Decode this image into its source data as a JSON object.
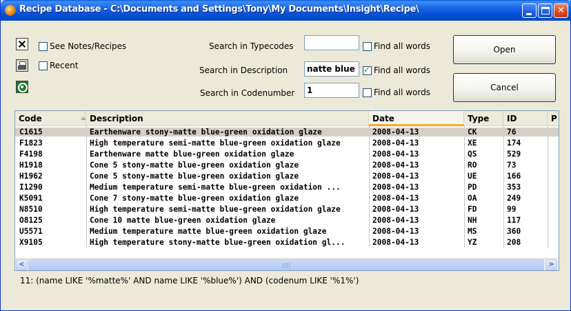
{
  "window": {
    "title": "Recipe Database - C:\\Documents and Settings\\Tony\\My Documents\\Insight\\Recipe\\"
  },
  "toolbar": {
    "icons": [
      "delete-icon",
      "print-icon",
      "target-icon"
    ],
    "see_notes_label": "See Notes/Recipes",
    "see_notes_checked": false,
    "recent_label": "Recent",
    "recent_checked": false
  },
  "search": {
    "typecodes_label": "Search in Typecodes",
    "typecodes_value": "",
    "typecodes_findall_label": "Find all words",
    "typecodes_findall_checked": false,
    "description_label": "Search in Description",
    "description_value": "natte blue",
    "description_findall_label": "Find all words",
    "description_findall_checked": true,
    "codenumber_label": "Search in Codenumber",
    "codenumber_value": "1",
    "codenumber_findall_label": "Find all words",
    "codenumber_findall_checked": false
  },
  "buttons": {
    "open": "Open",
    "cancel": "Cancel"
  },
  "table": {
    "columns": [
      "Code",
      "Description",
      "Date",
      "Type",
      "ID",
      "P"
    ],
    "sorted_column": "Date",
    "rows": [
      [
        "C1615",
        "Earthenware stony-matte blue-green oxidation glaze",
        "2008-04-13",
        "CK",
        "76"
      ],
      [
        "F1823",
        "High temperature semi-matte blue-green oxidation glaze",
        "2008-04-13",
        "XE",
        "174"
      ],
      [
        "F4198",
        "Earthenware matte blue-green oxidation glaze",
        "2008-04-13",
        "QS",
        "529"
      ],
      [
        "H1918",
        "Cone 5 stony-matte blue-green oxidation glaze",
        "2008-04-13",
        "RO",
        "73"
      ],
      [
        "H1962",
        "Cone 5 stony-matte blue-green oxidation glaze",
        "2008-04-13",
        "UE",
        "166"
      ],
      [
        "I1290",
        "Medium temperature semi-matte blue-green oxidation ...",
        "2008-04-13",
        "PD",
        "353"
      ],
      [
        "K5091",
        "Cone 7 stony-matte blue-green oxidation glaze",
        "2008-04-13",
        "OA",
        "249"
      ],
      [
        "N8510",
        "High temperature semi-matte blue-green oxidation glaze",
        "2008-04-13",
        "FD",
        "99"
      ],
      [
        "O8125",
        "Cone 10 matte blue-green oxidation glaze",
        "2008-04-13",
        "NH",
        "117"
      ],
      [
        "U5571",
        "Medium temperature matte blue-green oxidation glaze",
        "2008-04-13",
        "MS",
        "360"
      ],
      [
        "X9105",
        "High temperature stony-matte blue-green oxidation gl...",
        "2008-04-13",
        "YZ",
        "208"
      ]
    ],
    "selected_row": 0
  },
  "status": {
    "query": "11: (name LIKE '%matte%' AND name LIKE '%blue%') AND (codenum LIKE '%1%')"
  },
  "colors": {
    "titlebar": "#0550d7",
    "sort_indicator": "#f9a825",
    "selected_row": "#d4d0c8"
  }
}
